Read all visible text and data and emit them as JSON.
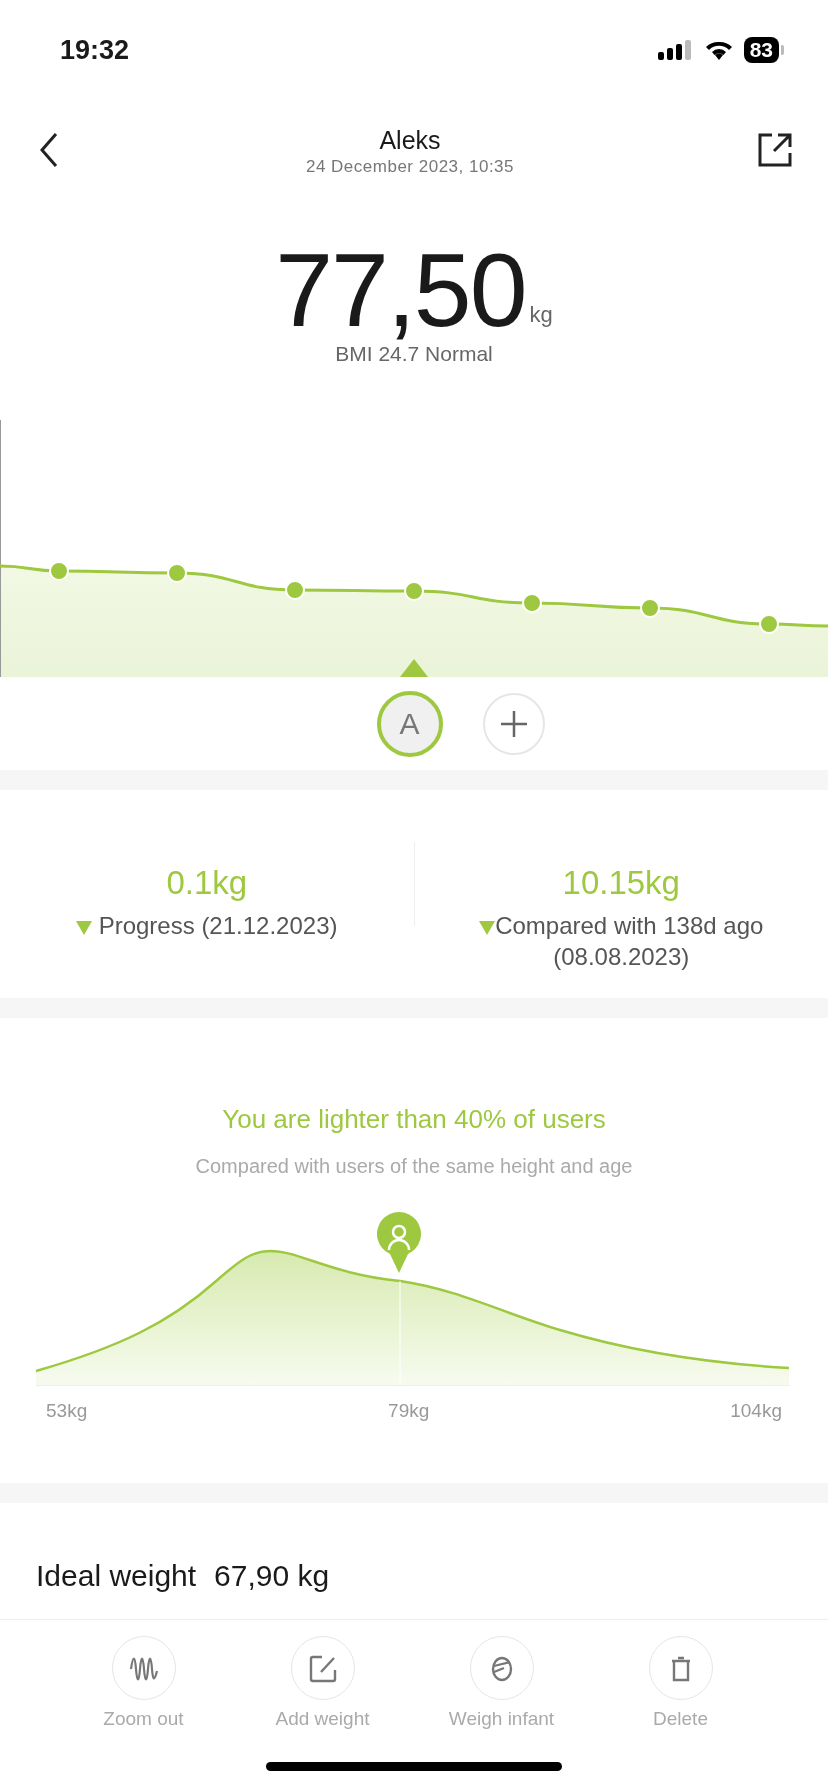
{
  "status_bar": {
    "time": "19:32",
    "battery": "83"
  },
  "header": {
    "title": "Aleks",
    "subtitle": "24 December 2023, 10:35"
  },
  "reading": {
    "value": "77,50",
    "unit": "kg",
    "bmi": "BMI 24.7 Normal"
  },
  "profiles": [
    {
      "label": "A",
      "selected": true
    }
  ],
  "stats": [
    {
      "value": "0.1kg",
      "label": "Progress (21.12.2023)"
    },
    {
      "value": "10.15kg",
      "label": "Compared with 138d ago (08.08.2023)"
    }
  ],
  "comparison": {
    "title": "You are lighter than 40% of users",
    "subtitle": "Compared with users of the same height and age",
    "axis_labels": [
      "53kg",
      "79kg",
      "104kg"
    ]
  },
  "ideal_weight": {
    "label": "Ideal weight",
    "value": "67,90 kg"
  },
  "toolbar": [
    {
      "label": "Zoom out",
      "kind": "wave"
    },
    {
      "label": "Add weight",
      "kind": "edit"
    },
    {
      "label": "Weigh infant",
      "kind": "infant"
    },
    {
      "label": "Delete",
      "kind": "trash"
    }
  ]
}
